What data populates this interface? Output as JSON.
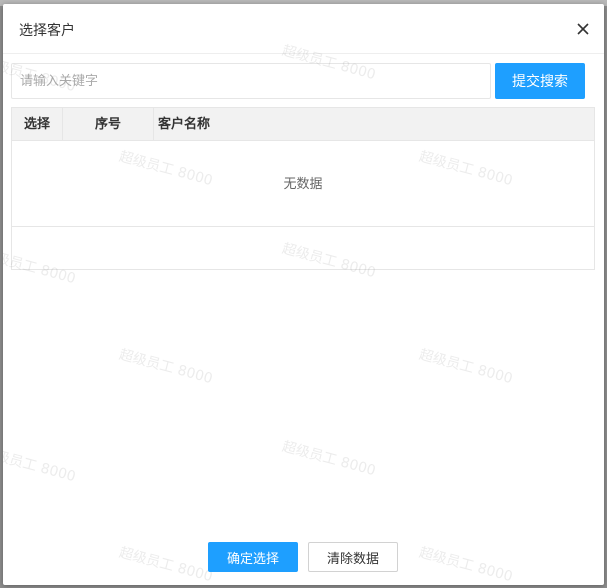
{
  "dialog": {
    "title": "选择客户",
    "close_icon": "close-icon"
  },
  "search": {
    "placeholder": "请输入关键字",
    "value": "",
    "button_label": "提交搜索"
  },
  "table": {
    "columns": [
      "选择",
      "序号",
      "客户名称"
    ],
    "rows": [],
    "empty_text": "无数据"
  },
  "footer": {
    "confirm_label": "确定选择",
    "clear_label": "清除数据"
  },
  "watermark": {
    "text": "超级员工 8000"
  },
  "colors": {
    "accent": "#1e9fff",
    "overlay": "#8f8f8f"
  }
}
